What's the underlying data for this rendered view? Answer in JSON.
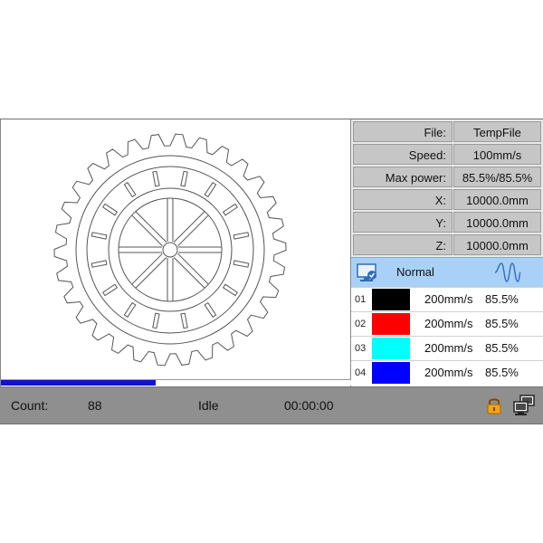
{
  "info": {
    "file_label": "File:",
    "file_value": "TempFile",
    "speed_label": "Speed:",
    "speed_value": "100mm/s",
    "power_label": "Max power:",
    "power_value": "85.5%/85.5%",
    "x_label": "X:",
    "x_value": "10000.0mm",
    "y_label": "Y:",
    "y_value": "10000.0mm",
    "z_label": "Z:",
    "z_value": "10000.0mm"
  },
  "mode": {
    "label": "Normal",
    "icon": "monitor-check-icon",
    "wave_icon": "waveform-icon"
  },
  "layers": [
    {
      "num": "01",
      "color": "#000000",
      "speed": "200mm/s",
      "power": "85.5%"
    },
    {
      "num": "02",
      "color": "#ff0000",
      "speed": "200mm/s",
      "power": "85.5%"
    },
    {
      "num": "03",
      "color": "#00ffff",
      "speed": "200mm/s",
      "power": "85.5%"
    },
    {
      "num": "04",
      "color": "#0000ff",
      "speed": "200mm/s",
      "power": "85.5%"
    }
  ],
  "progress": {
    "fraction": 0.44,
    "color": "#1212c8"
  },
  "status": {
    "count_label": "Count:",
    "count_value": "88",
    "state": "Idle",
    "time": "00:00:00",
    "lock_icon": "lock-icon",
    "network_icon": "network-icon"
  },
  "preview": {
    "design": "gear-wheel",
    "stroke": "#555555"
  }
}
